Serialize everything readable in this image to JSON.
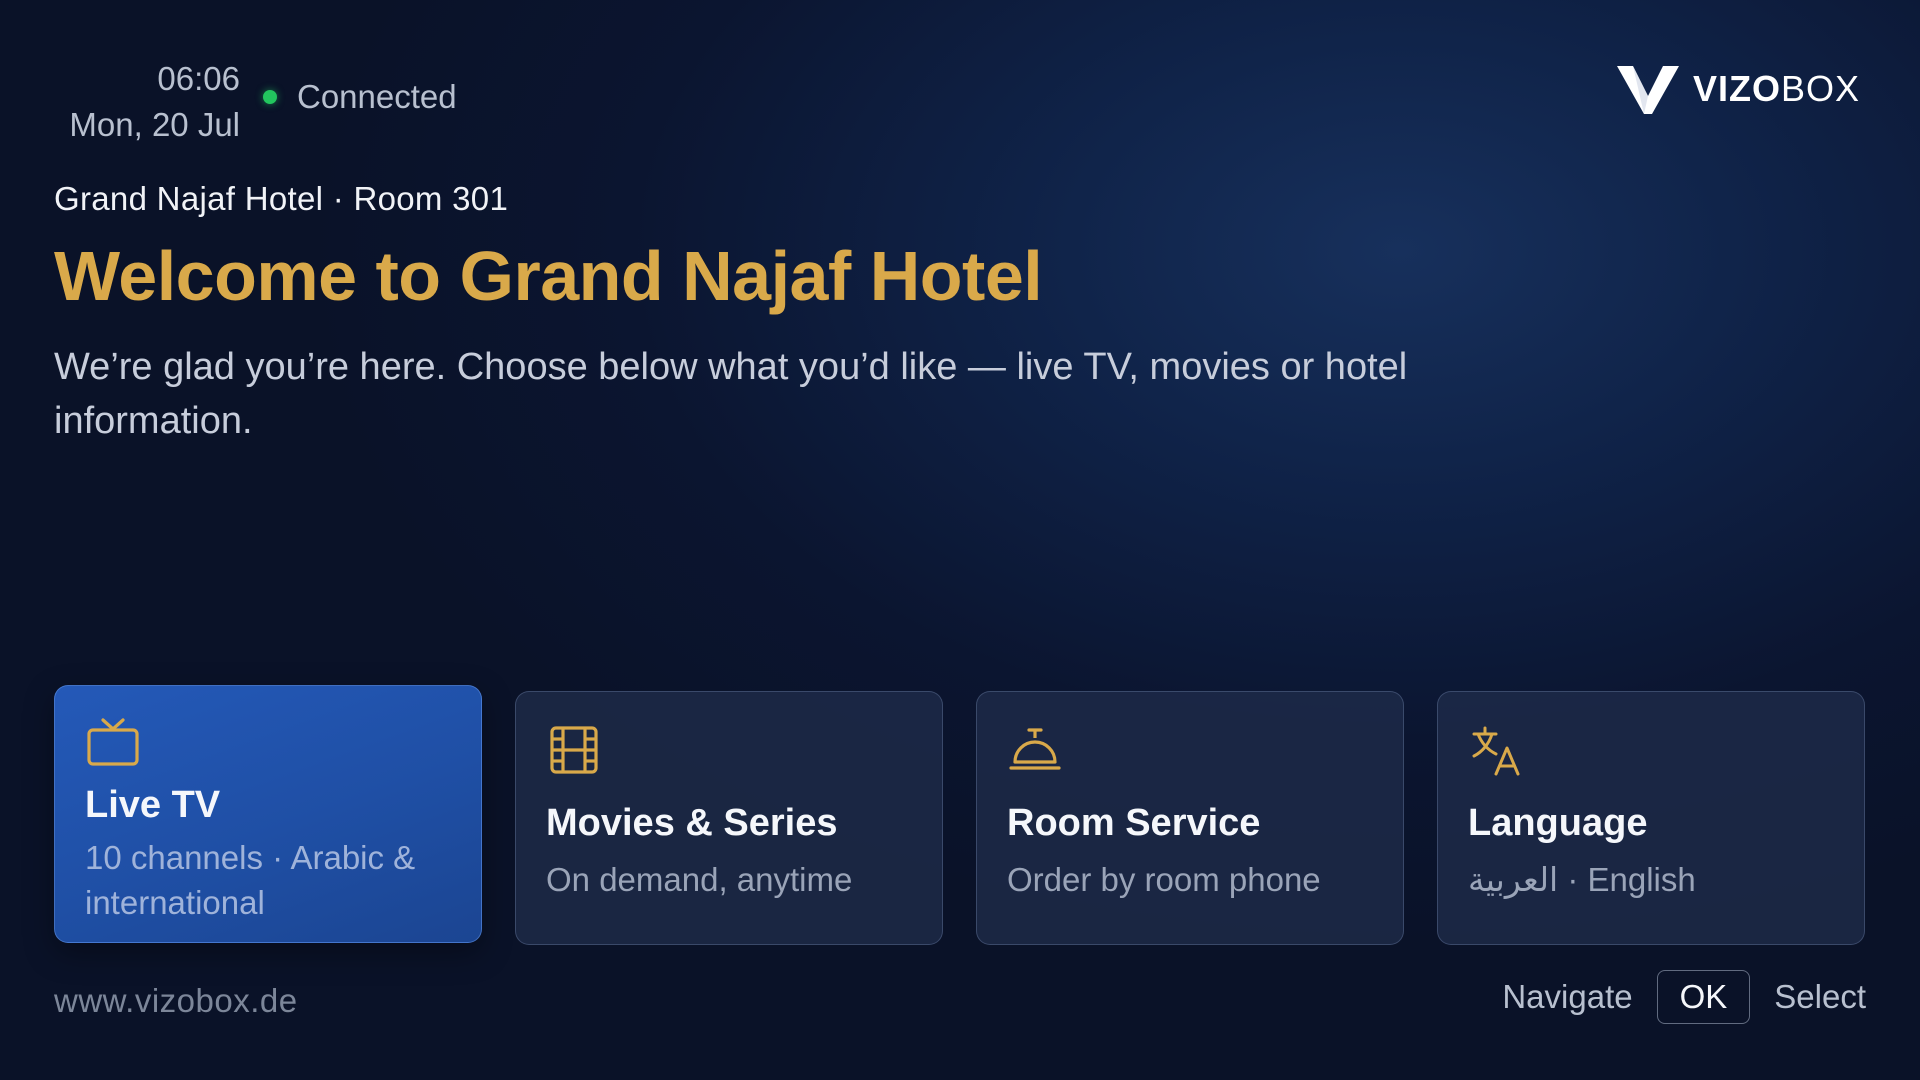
{
  "header": {
    "time": "06:06",
    "date": "Mon, 20 Jul",
    "connection_status": "Connected",
    "status_color": "#22c55e",
    "logo": {
      "bold": "VIZO",
      "light": "BOX"
    }
  },
  "main": {
    "location": "Grand Najaf Hotel · Room 301",
    "welcome_title": "Welcome to Grand Najaf Hotel",
    "intro": "We’re glad you’re here. Choose below what you’d like — live TV, movies or hotel information.",
    "accent_color": "#d9a94a"
  },
  "cards": [
    {
      "icon": "tv-icon",
      "title": "Live TV",
      "subtitle": "10 channels · Arabic & international",
      "selected": true
    },
    {
      "icon": "film-icon",
      "title": "Movies & Series",
      "subtitle": "On demand, anytime",
      "selected": false
    },
    {
      "icon": "service-bell-icon",
      "title": "Room Service",
      "subtitle": "Order by room phone",
      "selected": false
    },
    {
      "icon": "translate-icon",
      "title": "Language",
      "subtitle": "العربية · English",
      "selected": false
    }
  ],
  "footer": {
    "website": "www.vizobox.de",
    "hint_navigate": "Navigate",
    "hint_key": "OK",
    "hint_select": "Select"
  }
}
